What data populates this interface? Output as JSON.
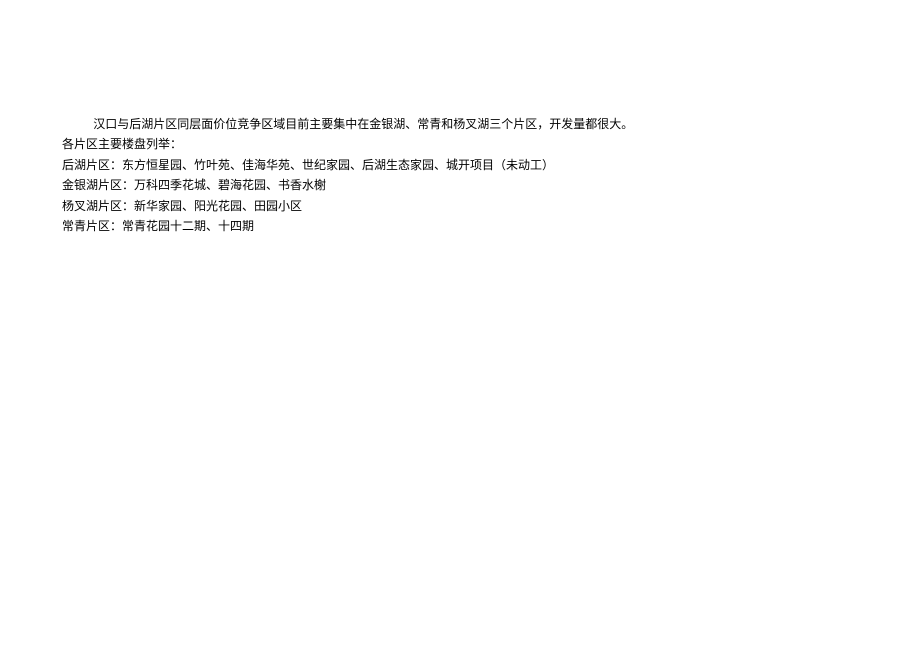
{
  "paragraphs": [
    {
      "text": "汉口与后湖片区同层面价位竞争区域目前主要集中在金银湖、常青和杨叉湖三个片区，开发量都很大。",
      "indented": true
    },
    {
      "text": "各片区主要楼盘列举：",
      "indented": false
    },
    {
      "text": "后湖片区：东方恒星园、竹叶苑、佳海华苑、世纪家园、后湖生态家园、城开项目（未动工）",
      "indented": false
    },
    {
      "text": "金银湖片区：万科四季花城、碧海花园、书香水榭",
      "indented": false
    },
    {
      "text": "杨叉湖片区：新华家园、阳光花园、田园小区",
      "indented": false
    },
    {
      "text": "常青片区：常青花园十二期、十四期",
      "indented": false
    }
  ]
}
